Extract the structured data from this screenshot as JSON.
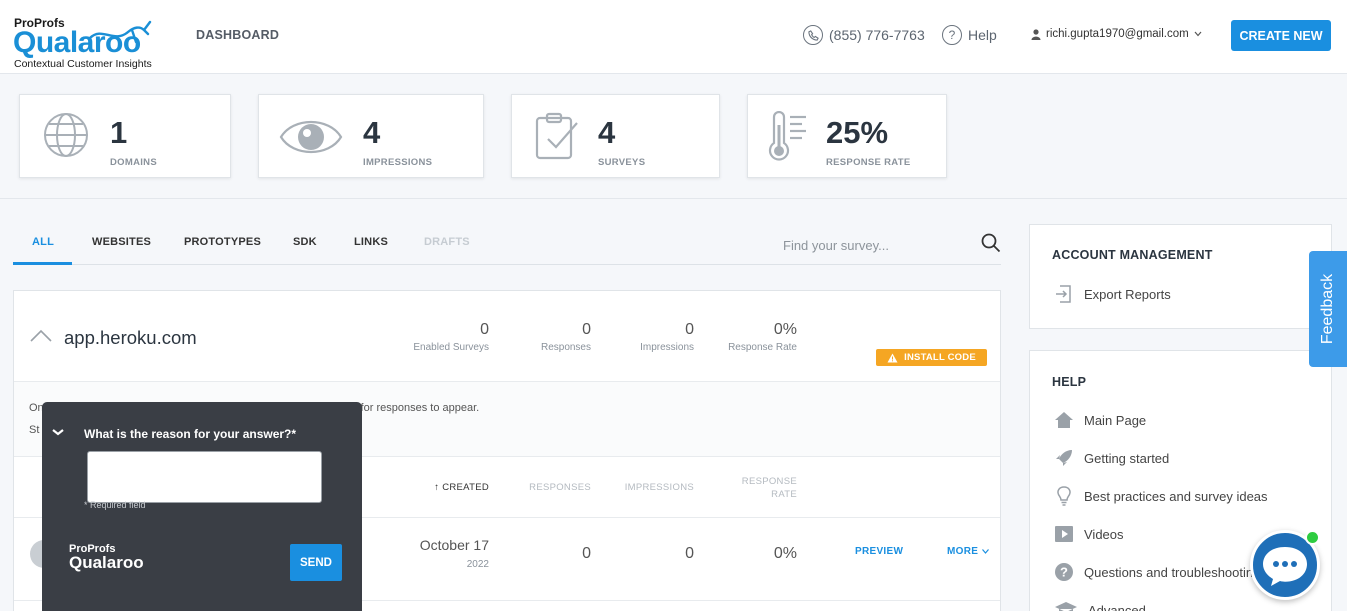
{
  "brand": {
    "proprofs": "ProProfs",
    "name": "Qualaroo",
    "tagline": "Contextual Customer Insights",
    "accent": "#1a8fe0"
  },
  "header": {
    "dashboard": "DASHBOARD",
    "phone": "(855) 776-7763",
    "help": "Help",
    "user_email": "richi.gupta1970@gmail.com",
    "create_new": "CREATE NEW"
  },
  "stats": [
    {
      "icon": "globe-icon",
      "value": "1",
      "label": "DOMAINS"
    },
    {
      "icon": "eye-icon",
      "value": "4",
      "label": "IMPRESSIONS"
    },
    {
      "icon": "clipboard-check-icon",
      "value": "4",
      "label": "SURVEYS"
    },
    {
      "icon": "thermometer-icon",
      "value": "25%",
      "label": "RESPONSE RATE"
    }
  ],
  "tabs": [
    {
      "label": "ALL",
      "active": true
    },
    {
      "label": "WEBSITES"
    },
    {
      "label": "PROTOTYPES"
    },
    {
      "label": "SDK"
    },
    {
      "label": "LINKS"
    },
    {
      "label": "DRAFTS",
      "disabled": true
    }
  ],
  "search": {
    "placeholder": "Find your survey..."
  },
  "domain": {
    "name": "app.heroku.com",
    "metrics": [
      {
        "value": "0",
        "label": "Enabled Surveys"
      },
      {
        "value": "0",
        "label": "Responses"
      },
      {
        "value": "0",
        "label": "Impressions"
      },
      {
        "value": "0%",
        "label": "Response Rate"
      }
    ],
    "install_code": "INSTALL CODE",
    "info_line1_start": "On",
    "info_line1_end": "s for responses to appear.",
    "info_line2_start": "St",
    "columns": {
      "created": "↑ CREATED",
      "responses": "RESPONSES",
      "impressions": "IMPRESSIONS",
      "response_rate_1": "RESPONSE",
      "response_rate_2": "RATE"
    },
    "row": {
      "date": "October 17",
      "year": "2022",
      "responses": "0",
      "impressions": "0",
      "rate": "0%",
      "preview": "PREVIEW",
      "more": "MORE"
    }
  },
  "account": {
    "title": "ACCOUNT MANAGEMENT",
    "items": [
      {
        "icon": "export-icon",
        "label": "Export Reports"
      }
    ]
  },
  "help_panel": {
    "title": "HELP",
    "items": [
      {
        "icon": "home-icon",
        "label": "Main Page"
      },
      {
        "icon": "rocket-icon",
        "label": "Getting started"
      },
      {
        "icon": "lightbulb-icon",
        "label": "Best practices and survey ideas"
      },
      {
        "icon": "video-icon",
        "label": "Videos"
      },
      {
        "icon": "question-icon",
        "label": "Questions and troubleshooting"
      },
      {
        "icon": "graduation-cap-icon",
        "label": "Advanced"
      }
    ]
  },
  "feedback": "Feedback",
  "survey_popup": {
    "question": "What is the reason for your answer?*",
    "required_note": "* Required field",
    "logo_top": "ProProfs",
    "logo_bottom": "Qualaroo",
    "send": "SEND"
  }
}
